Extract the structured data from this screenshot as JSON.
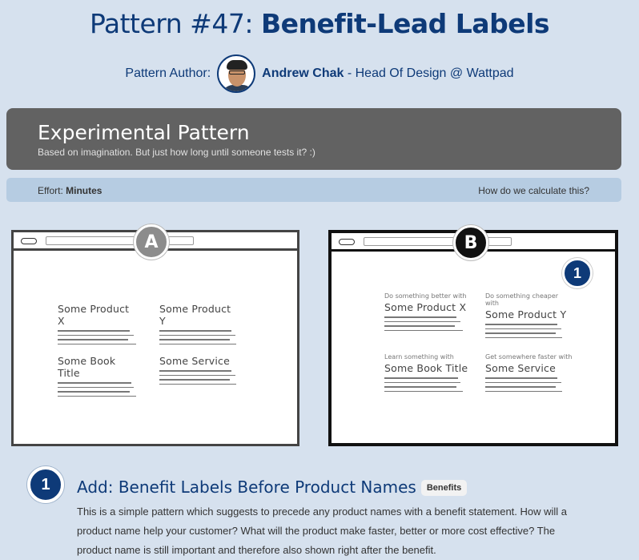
{
  "title": {
    "prefix": "Pattern #47: ",
    "name": "Benefit-Lead Labels"
  },
  "author": {
    "label": "Pattern Author:",
    "name": "Andrew Chak",
    "role": " - Head Of Design @ Wattpad"
  },
  "banner": {
    "heading": "Experimental Pattern",
    "subtitle": "Based on imagination. But just how long until someone tests it? :)"
  },
  "effort": {
    "label": "Effort: ",
    "value": "Minutes",
    "link": "How do we calculate this?"
  },
  "mockups": {
    "a": {
      "badge": "A",
      "items": [
        {
          "name": "Some Product X"
        },
        {
          "name": "Some Product Y"
        },
        {
          "name": "Some Book Title"
        },
        {
          "name": "Some Service"
        }
      ]
    },
    "b": {
      "badge": "B",
      "callout": "1",
      "items": [
        {
          "benefit": "Do something better with",
          "name": "Some Product X"
        },
        {
          "benefit": "Do something cheaper with",
          "name": "Some Product Y"
        },
        {
          "benefit": "Learn something with",
          "name": "Some Book Title"
        },
        {
          "benefit": "Get somewhere faster with",
          "name": "Some Service"
        }
      ]
    }
  },
  "step": {
    "number": "1",
    "title": "Add: Benefit Labels Before Product Names",
    "tag": "Benefits",
    "body": "This is a simple pattern which suggests to precede any product names with a benefit statement. How will a product name help your customer? What will the product make faster, better or more cost effective? The product name is still important and therefore also shown right after the benefit."
  },
  "colors": {
    "accent": "#0e3a78",
    "background": "#d6e1ee",
    "banner": "#626262",
    "effort_bar": "#b6cce2"
  },
  "icons": [
    "eye-icon"
  ]
}
